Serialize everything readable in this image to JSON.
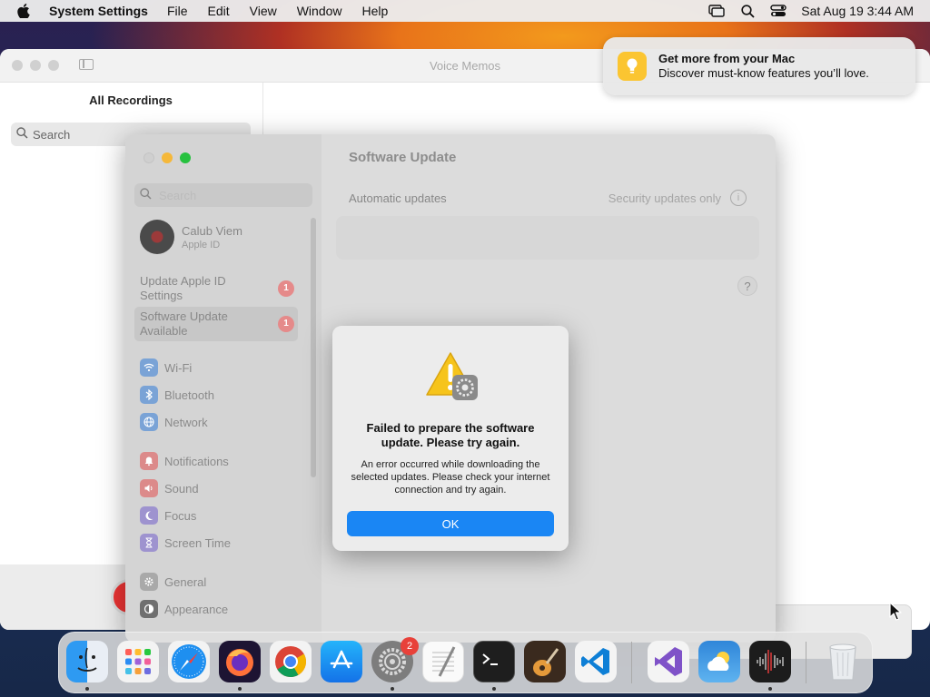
{
  "menubar": {
    "app_name": "System Settings",
    "menus": [
      "File",
      "Edit",
      "View",
      "Window",
      "Help"
    ],
    "clock": "Sat Aug 19  3:44 AM"
  },
  "voice_memos": {
    "title": "Voice Memos",
    "sidebar_heading": "All Recordings",
    "search_placeholder": "Search"
  },
  "notification": {
    "title": "Get more from your Mac",
    "body": "Discover must-know features you’ll love."
  },
  "settings": {
    "search_placeholder": "Search",
    "profile": {
      "name": "Calub Viem",
      "subtitle": "Apple ID"
    },
    "alerts": [
      {
        "label": "Update Apple ID Settings",
        "badge": "1"
      },
      {
        "label": "Software Update Available",
        "badge": "1"
      }
    ],
    "nav": {
      "group1": [
        "Wi-Fi",
        "Bluetooth",
        "Network"
      ],
      "group2": [
        "Notifications",
        "Sound",
        "Focus",
        "Screen Time"
      ],
      "group3": [
        "General",
        "Appearance"
      ]
    },
    "main_title": "Software Update",
    "row": {
      "label": "Automatic updates",
      "value": "Security updates only"
    },
    "help": "?"
  },
  "dialog": {
    "title": "Failed to prepare the software update. Please try again.",
    "message": "An error occurred while downloading the selected updates. Please check your internet connection and try again.",
    "ok_label": "OK"
  },
  "dock": {
    "system_settings_badge": "2",
    "apps": [
      "Finder",
      "Launchpad",
      "Safari",
      "Firefox",
      "Chrome",
      "App Store",
      "System Settings",
      "TextEdit",
      "Terminal",
      "GarageBand",
      "Visual Studio Code",
      "Visual Studio",
      "Weather",
      "Voice Memos",
      "Trash"
    ]
  }
}
